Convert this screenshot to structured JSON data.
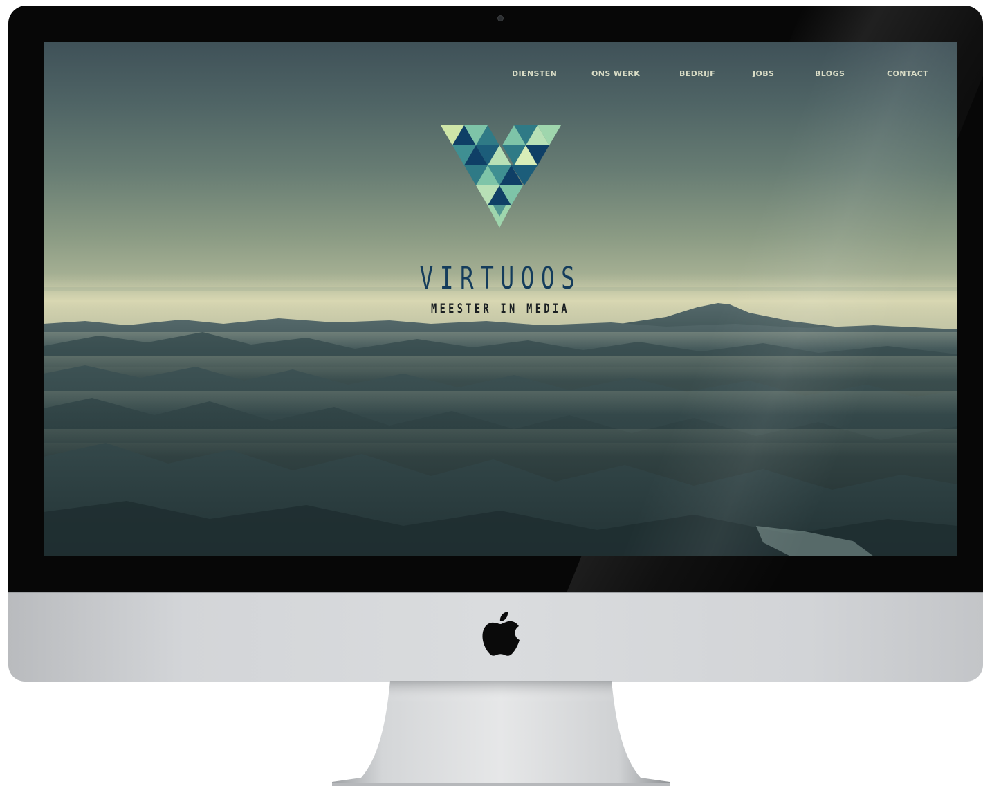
{
  "device": {
    "name": "imac",
    "accent_bezel": "#070707",
    "chin_color": "#d8dadc",
    "chin_icon": "apple-logo-icon",
    "camera_icon": "camera-icon"
  },
  "website": {
    "nav": {
      "items": [
        {
          "label": "DIENSTEN"
        },
        {
          "label": "ONS WERK"
        },
        {
          "label": "BEDRIJF"
        },
        {
          "label": "JOBS"
        },
        {
          "label": "BLOGS"
        },
        {
          "label": "CONTACT"
        }
      ],
      "text_color": "#d9dcc6"
    },
    "hero": {
      "logo_icon": "v-triangle-logo-icon",
      "logo_colors": [
        "#0f3f66",
        "#2f7a86",
        "#7ec4a8",
        "#b8e0b6",
        "#d8edb8"
      ],
      "brand_name": "VIRTUOOS",
      "tagline": "MEESTER IN MEDIA",
      "brand_color": "#143c5c",
      "background": "misty-mountain-landscape"
    }
  }
}
